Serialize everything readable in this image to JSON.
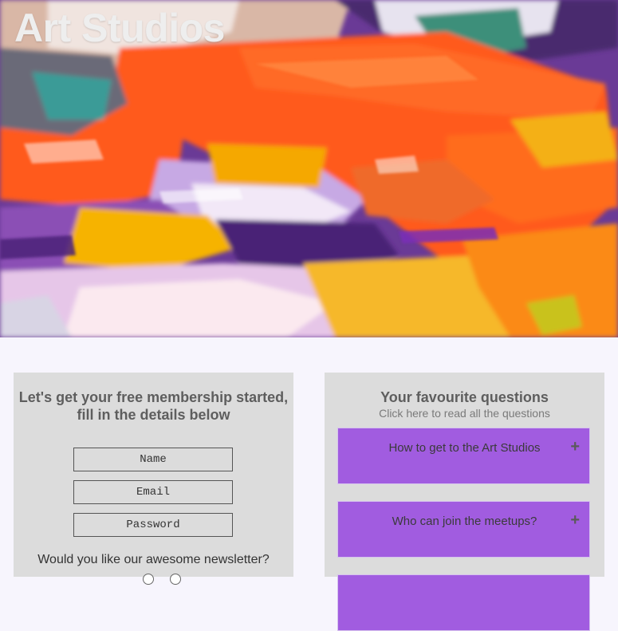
{
  "header": {
    "title": "Art Studios"
  },
  "membership": {
    "heading": "Let's get your free membership started, fill in the details below",
    "fields": {
      "name_placeholder": "Name",
      "email_placeholder": "Email",
      "password_placeholder": "Password"
    },
    "newsletter_question": "Would you like our awesome newsletter?"
  },
  "faq": {
    "heading": "Your favourite questions",
    "subheading": "Click here to read all the questions",
    "items": [
      {
        "question": "How to get to the Art Studios",
        "expand_icon": "plus-icon"
      },
      {
        "question": "Who can join the meetups?",
        "expand_icon": "plus-icon"
      }
    ]
  },
  "colors": {
    "page_background": "#f7f5fd",
    "card_background": "#dcdcdc",
    "faq_item_background": "#a15ce0",
    "title_color": "#eeeeee"
  }
}
